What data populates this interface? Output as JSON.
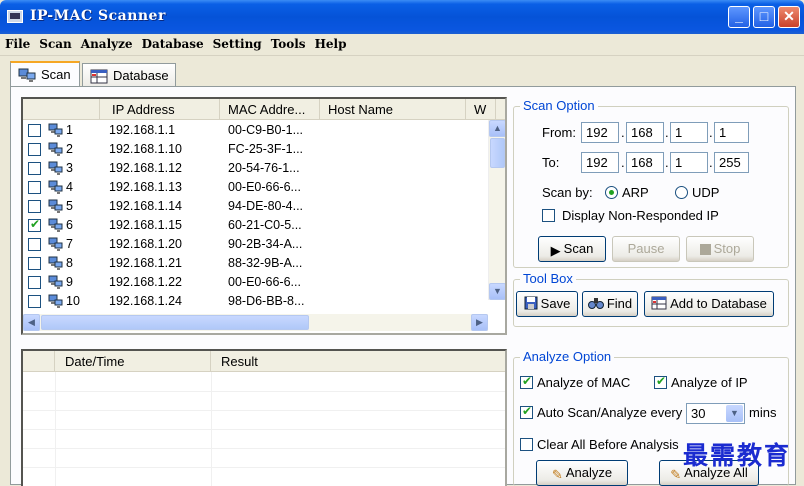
{
  "window": {
    "title": "IP-MAC Scanner"
  },
  "menu": [
    "File",
    "Scan",
    "Analyze",
    "Database",
    "Setting",
    "Tools",
    "Help"
  ],
  "tabs": [
    {
      "label": "Scan",
      "active": true
    },
    {
      "label": "Database",
      "active": false
    }
  ],
  "scan_grid": {
    "columns": [
      "IP Address",
      "MAC Addre...",
      "Host Name",
      "W"
    ],
    "rows": [
      {
        "n": "1",
        "ip": "192.168.1.1",
        "mac": "00-C9-B0-1...",
        "checked": false
      },
      {
        "n": "2",
        "ip": "192.168.1.10",
        "mac": "FC-25-3F-1...",
        "checked": false
      },
      {
        "n": "3",
        "ip": "192.168.1.12",
        "mac": "20-54-76-1...",
        "checked": false
      },
      {
        "n": "4",
        "ip": "192.168.1.13",
        "mac": "00-E0-66-6...",
        "checked": false
      },
      {
        "n": "5",
        "ip": "192.168.1.14",
        "mac": "94-DE-80-4...",
        "checked": false
      },
      {
        "n": "6",
        "ip": "192.168.1.15",
        "mac": "60-21-C0-5...",
        "checked": true
      },
      {
        "n": "7",
        "ip": "192.168.1.20",
        "mac": "90-2B-34-A...",
        "checked": false
      },
      {
        "n": "8",
        "ip": "192.168.1.21",
        "mac": "88-32-9B-A...",
        "checked": false
      },
      {
        "n": "9",
        "ip": "192.168.1.22",
        "mac": "00-E0-66-6...",
        "checked": false
      },
      {
        "n": "10",
        "ip": "192.168.1.24",
        "mac": "98-D6-BB-8...",
        "checked": false
      }
    ]
  },
  "result_grid": {
    "columns": [
      "Date/Time",
      "Result"
    ]
  },
  "scan_option": {
    "legend": "Scan Option",
    "from_label": "From:",
    "from": [
      "192",
      "168",
      "1",
      "1"
    ],
    "to_label": "To:",
    "to": [
      "192",
      "168",
      "1",
      "255"
    ],
    "scan_by_label": "Scan by:",
    "arp_label": "ARP",
    "udp_label": "UDP",
    "scan_by_selected": "ARP",
    "display_non_responded_label": "Display Non-Responded IP",
    "display_non_responded": false,
    "scan_btn": "Scan",
    "pause_btn": "Pause",
    "stop_btn": "Stop"
  },
  "tool_box": {
    "legend": "Tool Box",
    "save_btn": "Save",
    "find_btn": "Find",
    "add_db_btn": "Add to Database"
  },
  "analyze_option": {
    "legend": "Analyze Option",
    "analyze_mac_label": "Analyze of MAC",
    "analyze_mac": true,
    "analyze_ip_label": "Analyze of IP",
    "analyze_ip": true,
    "auto_scan_label": "Auto Scan/Analyze every",
    "auto_scan": true,
    "interval_value": "30",
    "interval_unit": "mins",
    "clear_all_label": "Clear All Before Analysis",
    "clear_all": false,
    "analyze_btn": "Analyze",
    "analyze_all_btn": "Analyze All"
  },
  "watermark": "最需教育",
  "colors": {
    "title_blue": "#0553d8",
    "legend_blue": "#0046d5",
    "check_green": "#21a121"
  }
}
